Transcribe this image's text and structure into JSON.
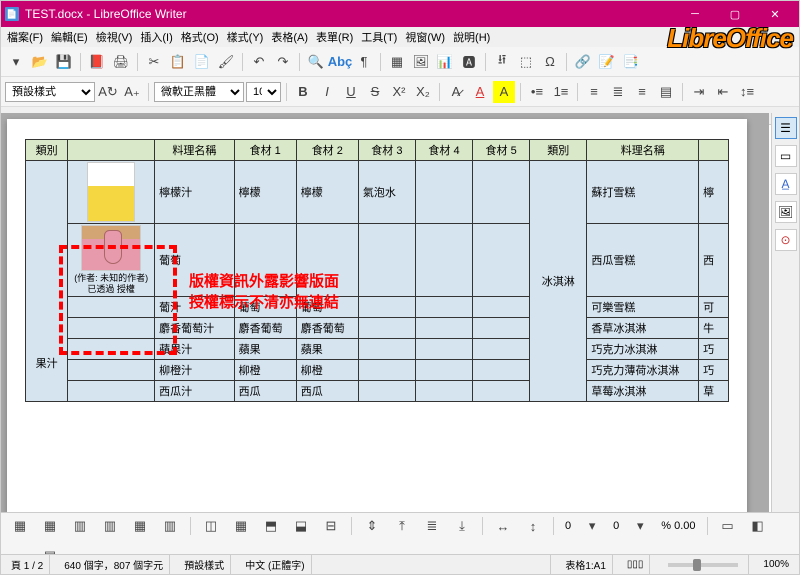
{
  "window": {
    "title": "TEST.docx - LibreOffice Writer",
    "brand": "LibreOffice"
  },
  "menu": [
    "檔案(F)",
    "編輯(E)",
    "檢視(V)",
    "插入(I)",
    "格式(O)",
    "樣式(Y)",
    "表格(A)",
    "表單(R)",
    "工具(T)",
    "視窗(W)",
    "說明(H)"
  ],
  "format_toolbar": {
    "style": "預設樣式",
    "font": "微軟正黑體",
    "size": "10"
  },
  "table": {
    "headers_left": [
      "類別",
      "",
      "料理名稱",
      "食材 1",
      "食材 2",
      "食材 3",
      "食材 4",
      "食材 5"
    ],
    "headers_right": [
      "類別",
      "料理名稱",
      ""
    ],
    "category_left": "果汁",
    "category_right": "冰淇淋",
    "caption_text": "(作者: 未知的作者) 已透過 授權",
    "rows_left": [
      {
        "name": "檸檬汁",
        "ing": [
          "檸檬",
          "檸檬",
          "氣泡水",
          "",
          ""
        ]
      },
      {
        "name": "葡萄",
        "ing": [
          "",
          "",
          "",
          "",
          ""
        ]
      },
      {
        "name": "葡汁",
        "ing": [
          "葡萄",
          "葡萄",
          "",
          "",
          ""
        ]
      },
      {
        "name": "麝香葡萄汁",
        "ing": [
          "麝香葡萄",
          "麝香葡萄",
          "",
          "",
          ""
        ]
      },
      {
        "name": "蘋果汁",
        "ing": [
          "蘋果",
          "蘋果",
          "",
          "",
          ""
        ]
      },
      {
        "name": "柳橙汁",
        "ing": [
          "柳橙",
          "柳橙",
          "",
          "",
          ""
        ]
      },
      {
        "name": "西瓜汁",
        "ing": [
          "西瓜",
          "西瓜",
          "",
          "",
          ""
        ]
      }
    ],
    "rows_right": [
      {
        "name": "蘇打雪糕",
        "extra": "檸"
      },
      {
        "name": "西瓜雪糕",
        "extra": "西"
      },
      {
        "name": "可樂雪糕",
        "extra": "可"
      },
      {
        "name": "香草冰淇淋",
        "extra": "牛"
      },
      {
        "name": "巧克力冰淇淋",
        "extra": "巧"
      },
      {
        "name": "巧克力薄荷冰淇淋",
        "extra": "巧"
      },
      {
        "name": "草莓冰淇淋",
        "extra": "草"
      }
    ]
  },
  "callout": {
    "line1": "版權資訊外露影響版面",
    "line2": "授權標示不清亦無連結"
  },
  "bottom_toolbar": {
    "val1": "0",
    "val2": "0",
    "unit": "% 0.00"
  },
  "statusbar": {
    "page": "頁 1 / 2",
    "words": "640 個字，807 個字元",
    "style": "預設樣式",
    "lang": "中文 (正體字)",
    "cell": "表格1:A1",
    "zoom": "100%"
  }
}
